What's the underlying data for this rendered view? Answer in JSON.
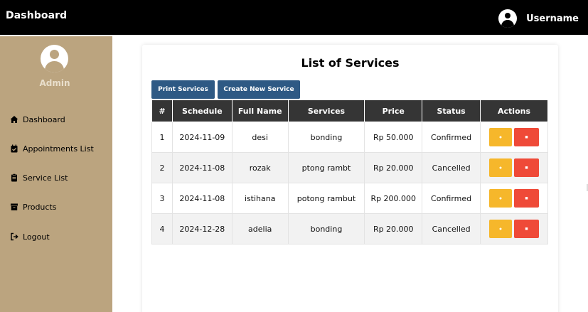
{
  "header": {
    "brand": "Dashboard",
    "username": "Username"
  },
  "sidebar": {
    "admin_label": "Admin",
    "items": [
      {
        "label": "Dashboard",
        "icon": "home-icon"
      },
      {
        "label": "Appointments List",
        "icon": "calendar-check-icon"
      },
      {
        "label": "Service List",
        "icon": "clipboard-icon"
      },
      {
        "label": "Products",
        "icon": "archive-icon"
      },
      {
        "label": "Logout",
        "icon": "logout-icon"
      }
    ]
  },
  "main": {
    "title": "List of Services",
    "print_label": "Print Services",
    "create_label": "Create New Service",
    "columns": [
      "#",
      "Schedule",
      "Full Name",
      "Services",
      "Price",
      "Status",
      "Actions"
    ],
    "rows": [
      {
        "num": "1",
        "schedule": "2024-11-09",
        "name": "desi",
        "service": "bonding",
        "price": "Rp 50.000",
        "status": "Confirmed"
      },
      {
        "num": "2",
        "schedule": "2024-11-08",
        "name": "rozak",
        "service": "ptong rambt",
        "price": "Rp 20.000",
        "status": "Cancelled"
      },
      {
        "num": "3",
        "schedule": "2024-11-08",
        "name": "istihana",
        "service": "potong rambut",
        "price": "Rp 200.000",
        "status": "Confirmed"
      },
      {
        "num": "4",
        "schedule": "2024-12-28",
        "name": "adelia",
        "service": "bonding",
        "price": "Rp 20.000",
        "status": "Cancelled"
      }
    ]
  },
  "colors": {
    "topbar": "#000000",
    "sidebar": "#bba47f",
    "button_primary": "#2e5984",
    "table_header": "#353535",
    "edit_button": "#f6b72b",
    "delete_button": "#ef4a38"
  }
}
